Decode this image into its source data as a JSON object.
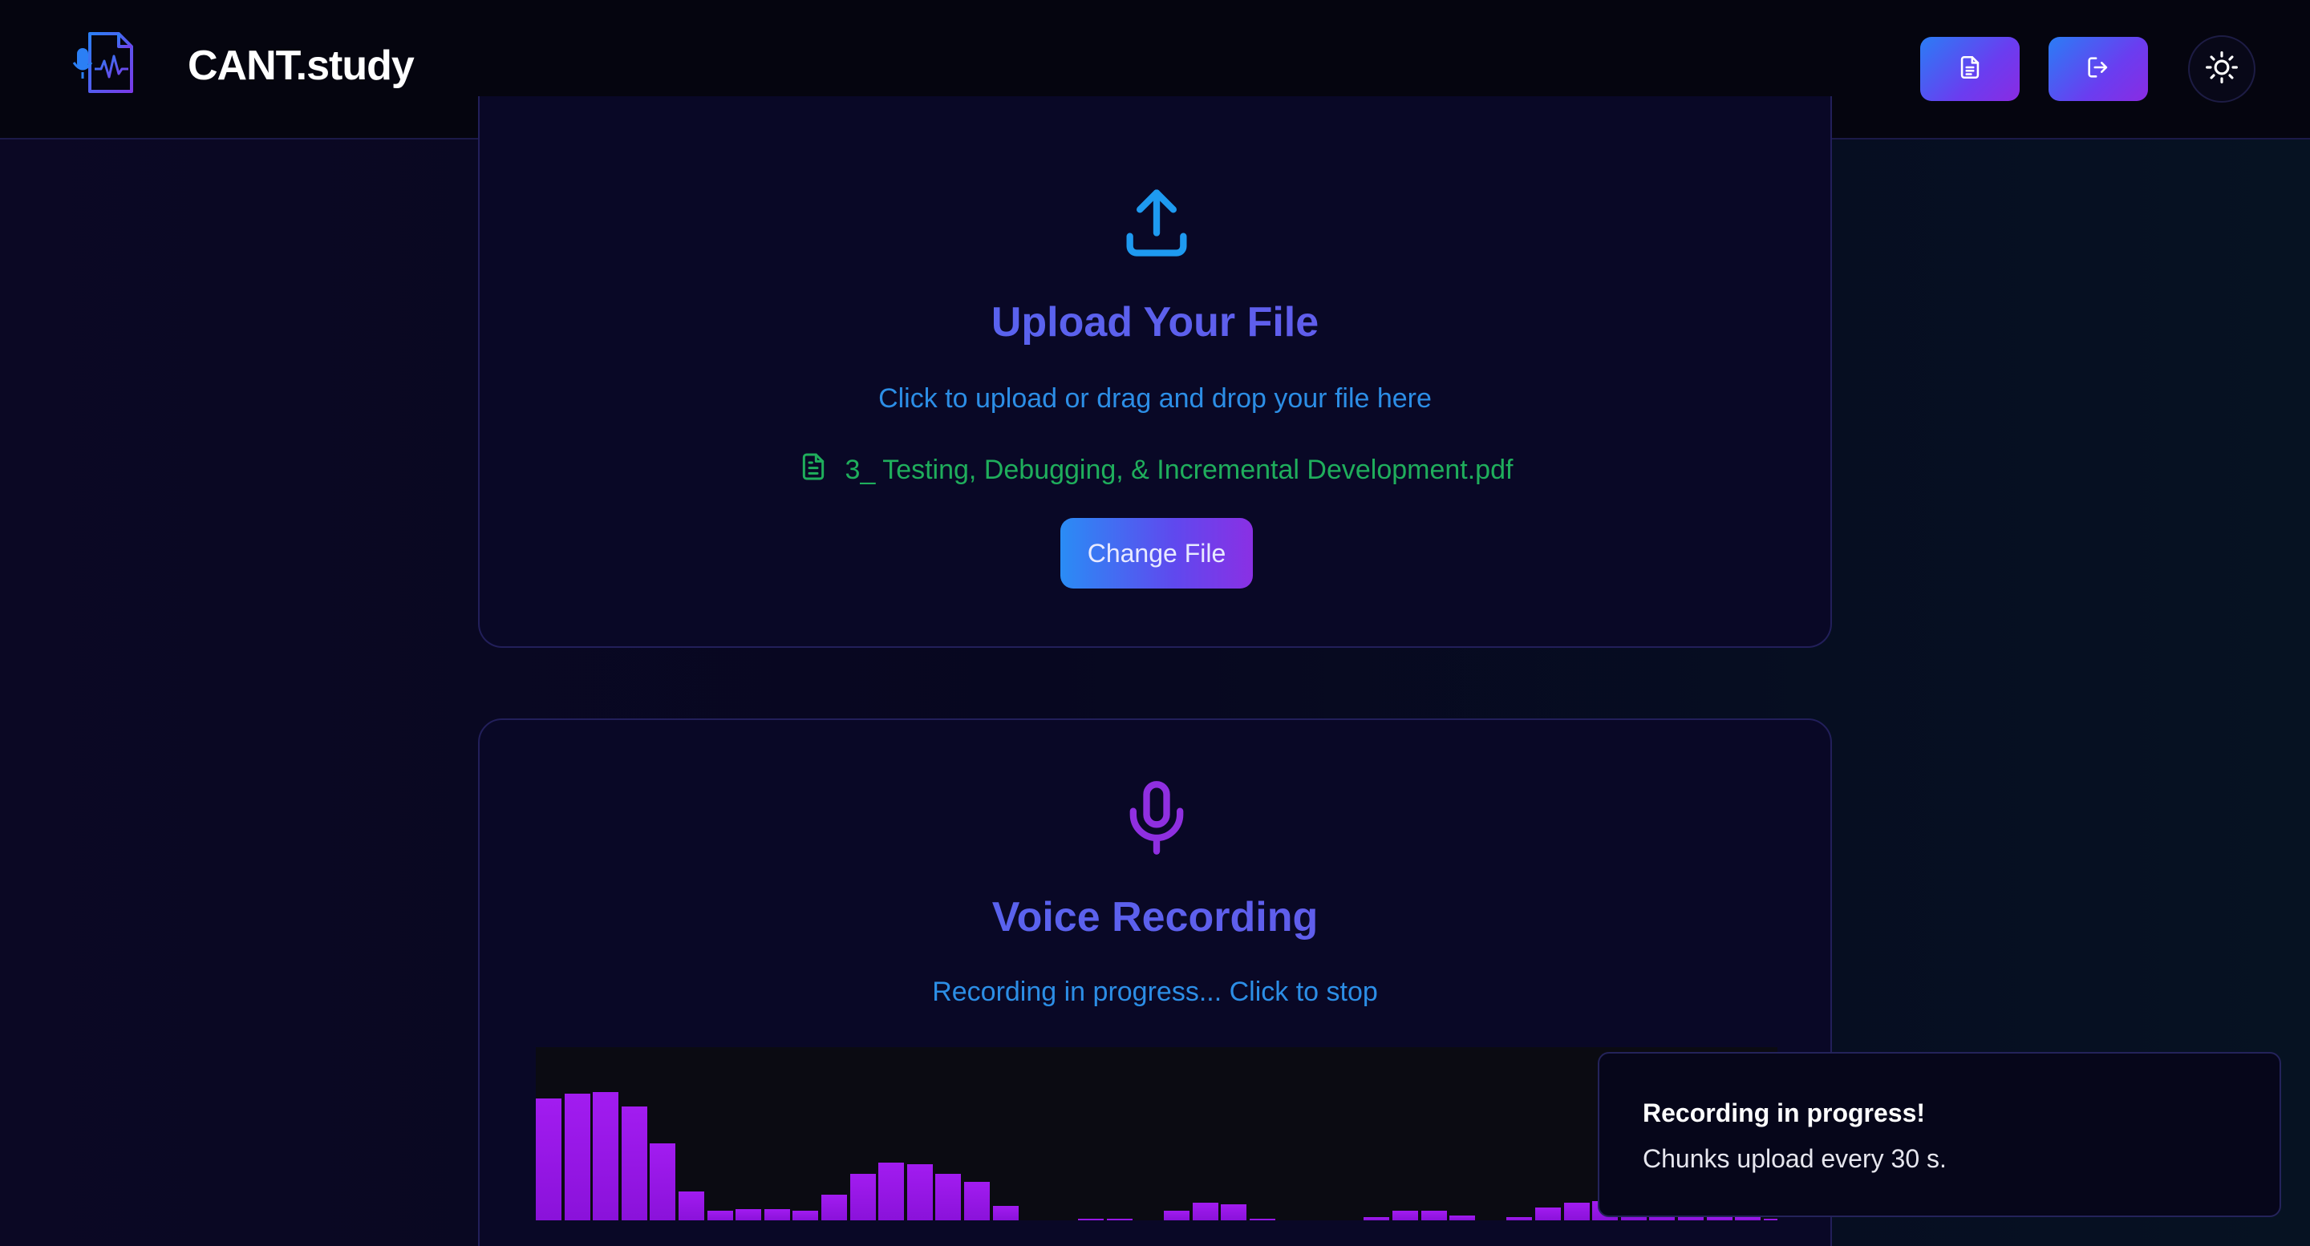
{
  "app": {
    "title": "CANT.study",
    "logo_icon": "document-microphone-waveform-icon"
  },
  "header": {
    "notes_button_icon": "document-icon",
    "logout_button_icon": "logout-icon",
    "theme_toggle_icon": "sun-icon"
  },
  "upload": {
    "icon": "upload-icon",
    "title": "Upload Your File",
    "subtitle": "Click to upload or drag and drop your file here",
    "file_icon": "file-text-icon",
    "file_name": "3_ Testing, Debugging, & Incremental Development.pdf",
    "change_label": "Change File"
  },
  "voice": {
    "icon": "microphone-icon",
    "title": "Voice Recording",
    "status": "Recording in progress... Click to stop",
    "levels": [
      0.76,
      0.79,
      0.8,
      0.71,
      0.48,
      0.18,
      0.06,
      0.07,
      0.07,
      0.06,
      0.16,
      0.29,
      0.36,
      0.35,
      0.29,
      0.24,
      0.09,
      0,
      0,
      0.01,
      0.01,
      0,
      0.06,
      0.11,
      0.1,
      0.01,
      0,
      0,
      0,
      0.02,
      0.06,
      0.06,
      0.03,
      0,
      0.02,
      0.08,
      0.11,
      0.12,
      0.08,
      0.05,
      0.03,
      0.02,
      0.02,
      0.01,
      0.01,
      0.01,
      0.01,
      0.01,
      0.01,
      0.01,
      0.01,
      0.01,
      0.01,
      0.01,
      0.01,
      0.01,
      0.01,
      0.01,
      0.01,
      0.01,
      0.01,
      0.01,
      0.01,
      0.01,
      0.01,
      0.01,
      0.01,
      0.01,
      0.01,
      0.01,
      0.01,
      0.01,
      0.01,
      0.01,
      0.01,
      0.01,
      0.01,
      0.01,
      0.01,
      0.01
    ]
  },
  "colors": {
    "accent_blue": "#2a8cf5",
    "accent_purple": "#8a30e4",
    "title_indigo": "#5a67f0",
    "file_green": "#1fae5c",
    "bar_purple": "#a21cf0"
  },
  "toast": {
    "title": "Recording in progress!",
    "body": "Chunks upload every 30 s."
  }
}
